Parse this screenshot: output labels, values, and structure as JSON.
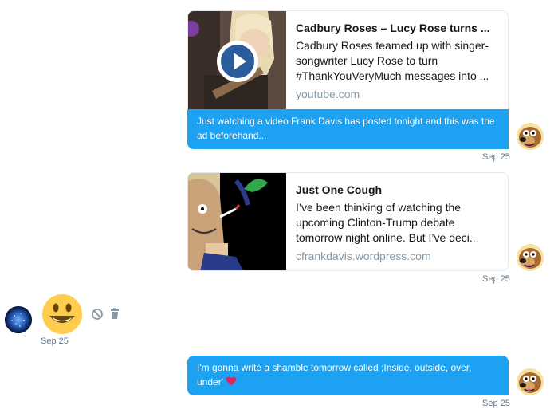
{
  "messages": [
    {
      "card": {
        "title": "Cadbury Roses – Lucy Rose turns ...",
        "description": "Cadbury Roses teamed up with singer-songwriter Lucy Rose to turn #ThankYouVeryMuch messages into ...",
        "domain": "youtube.com"
      },
      "text": "Just watching a video Frank Davis has posted tonight and this was the ad beforehand...",
      "time": "Sep 25"
    },
    {
      "card": {
        "title": "Just One Cough",
        "description": "I’ve been thinking of watching the upcoming Clinton-Trump debate tomorrow night  online. But I’ve deci...",
        "domain": "cfrankdavis.wordpress.com"
      },
      "time": "Sep 25"
    },
    {
      "emoji": "smiley",
      "time": "Sep 25"
    },
    {
      "text": "I'm gonna write a shamble tomorrow called ;Inside, outside, over, under'",
      "time": "Sep 25"
    }
  ],
  "icons": {
    "play": "play-icon",
    "block": "block-icon",
    "delete": "trash-icon",
    "heart": "heart-icon"
  },
  "colors": {
    "bubble": "#1da1f2",
    "timestamp": "#657786",
    "domain": "#8899a6",
    "heart": "#e0245e",
    "emoji": "#ffcc4d"
  }
}
